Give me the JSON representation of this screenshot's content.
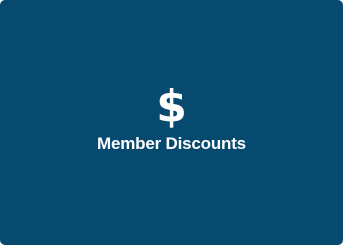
{
  "tile": {
    "label": "Member Discounts",
    "icon": "dollar-sign-icon",
    "icon_glyph": "$",
    "background_color": "#064A70",
    "text_color": "#FFFFFF"
  }
}
